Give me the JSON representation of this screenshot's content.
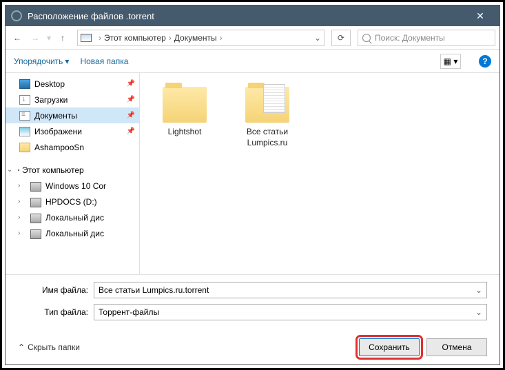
{
  "titlebar": {
    "title": "Расположение файлов .torrent"
  },
  "breadcrumb": {
    "root": "Этот компьютер",
    "folder": "Документы"
  },
  "search": {
    "placeholder": "Поиск: Документы"
  },
  "toolbar": {
    "organize": "Упорядочить",
    "new_folder": "Новая папка"
  },
  "sidebar": {
    "quick": [
      {
        "label": "Desktop",
        "icon": "desktop",
        "pinned": true
      },
      {
        "label": "Загрузки",
        "icon": "downloads",
        "pinned": true
      },
      {
        "label": "Документы",
        "icon": "docs",
        "pinned": true,
        "selected": true
      },
      {
        "label": "Изображени",
        "icon": "images",
        "pinned": true
      },
      {
        "label": "AshampooSn",
        "icon": "folder",
        "pinned": false
      }
    ],
    "pc_label": "Этот компьютер",
    "drives": [
      {
        "label": "Windows 10 Cor",
        "icon": "drive"
      },
      {
        "label": "HPDOCS (D:)",
        "icon": "drive"
      },
      {
        "label": "Локальный дис",
        "icon": "drive"
      },
      {
        "label": "Локальный дис",
        "icon": "drive"
      }
    ]
  },
  "content": {
    "items": [
      {
        "label": "Lightshot",
        "paper": false
      },
      {
        "label": "Все статьи Lumpics.ru",
        "paper": true
      }
    ]
  },
  "form": {
    "filename_label": "Имя файла:",
    "filename_value": "Все статьи Lumpics.ru.torrent",
    "filetype_label": "Тип файла:",
    "filetype_value": "Торрент-файлы"
  },
  "footer": {
    "hide_folders": "Скрыть папки",
    "save": "Сохранить",
    "cancel": "Отмена"
  }
}
